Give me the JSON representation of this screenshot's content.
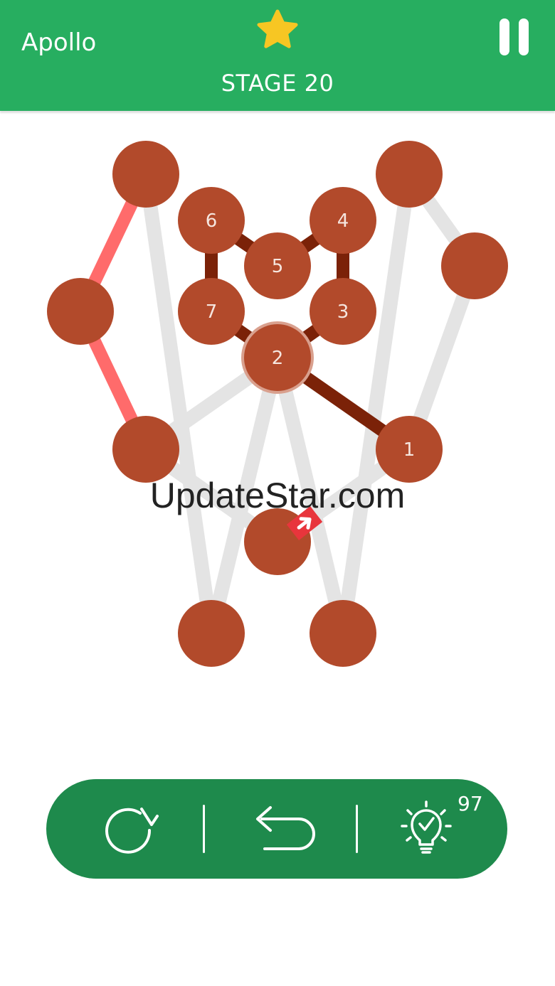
{
  "header": {
    "player_name": "Apollo",
    "stage": "STAGE 20"
  },
  "toolbar": {
    "hint_count": "97"
  },
  "watermark": "UpdateStar.com",
  "colors": {
    "header": "#27ae60",
    "toolbar": "#1e8a4c",
    "node": "#b24a2b",
    "path_done": "#7b2208",
    "path_active": "#ff6b6b",
    "edge_idle": "#e4e4e4",
    "star": "#f7c623",
    "start_marker": "#e8353c"
  },
  "puzzle": {
    "nodes": [
      {
        "id": "n1",
        "label": "1"
      },
      {
        "id": "n2",
        "label": "2"
      },
      {
        "id": "n3",
        "label": "3"
      },
      {
        "id": "n4",
        "label": "4"
      },
      {
        "id": "n5",
        "label": "5"
      },
      {
        "id": "n6",
        "label": "6"
      },
      {
        "id": "n7",
        "label": "7"
      },
      {
        "id": "tl",
        "label": ""
      },
      {
        "id": "tr",
        "label": ""
      },
      {
        "id": "l",
        "label": ""
      },
      {
        "id": "r",
        "label": ""
      },
      {
        "id": "ml",
        "label": ""
      },
      {
        "id": "c",
        "label": ""
      },
      {
        "id": "bl",
        "label": ""
      },
      {
        "id": "br",
        "label": ""
      }
    ],
    "edges": [
      {
        "from": "tl",
        "to": "bl",
        "state": "idle"
      },
      {
        "from": "tr",
        "to": "br",
        "state": "idle"
      },
      {
        "from": "tr",
        "to": "r",
        "state": "idle"
      },
      {
        "from": "r",
        "to": "n1",
        "state": "idle"
      },
      {
        "from": "ml",
        "to": "n2",
        "state": "idle"
      },
      {
        "from": "ml",
        "to": "c",
        "state": "idle"
      },
      {
        "from": "n1",
        "to": "c",
        "state": "idle"
      },
      {
        "from": "n2",
        "to": "bl",
        "state": "idle"
      },
      {
        "from": "n2",
        "to": "br",
        "state": "idle"
      },
      {
        "from": "tl",
        "to": "l",
        "state": "active"
      },
      {
        "from": "l",
        "to": "ml",
        "state": "active"
      },
      {
        "from": "n1",
        "to": "n2",
        "state": "done"
      },
      {
        "from": "n2",
        "to": "n3",
        "state": "done"
      },
      {
        "from": "n3",
        "to": "n4",
        "state": "done"
      },
      {
        "from": "n4",
        "to": "n5",
        "state": "done"
      },
      {
        "from": "n5",
        "to": "n6",
        "state": "done"
      },
      {
        "from": "n6",
        "to": "n7",
        "state": "done"
      },
      {
        "from": "n7",
        "to": "n2",
        "state": "done"
      }
    ],
    "current_node": "n2",
    "start_marker_node": "c"
  }
}
